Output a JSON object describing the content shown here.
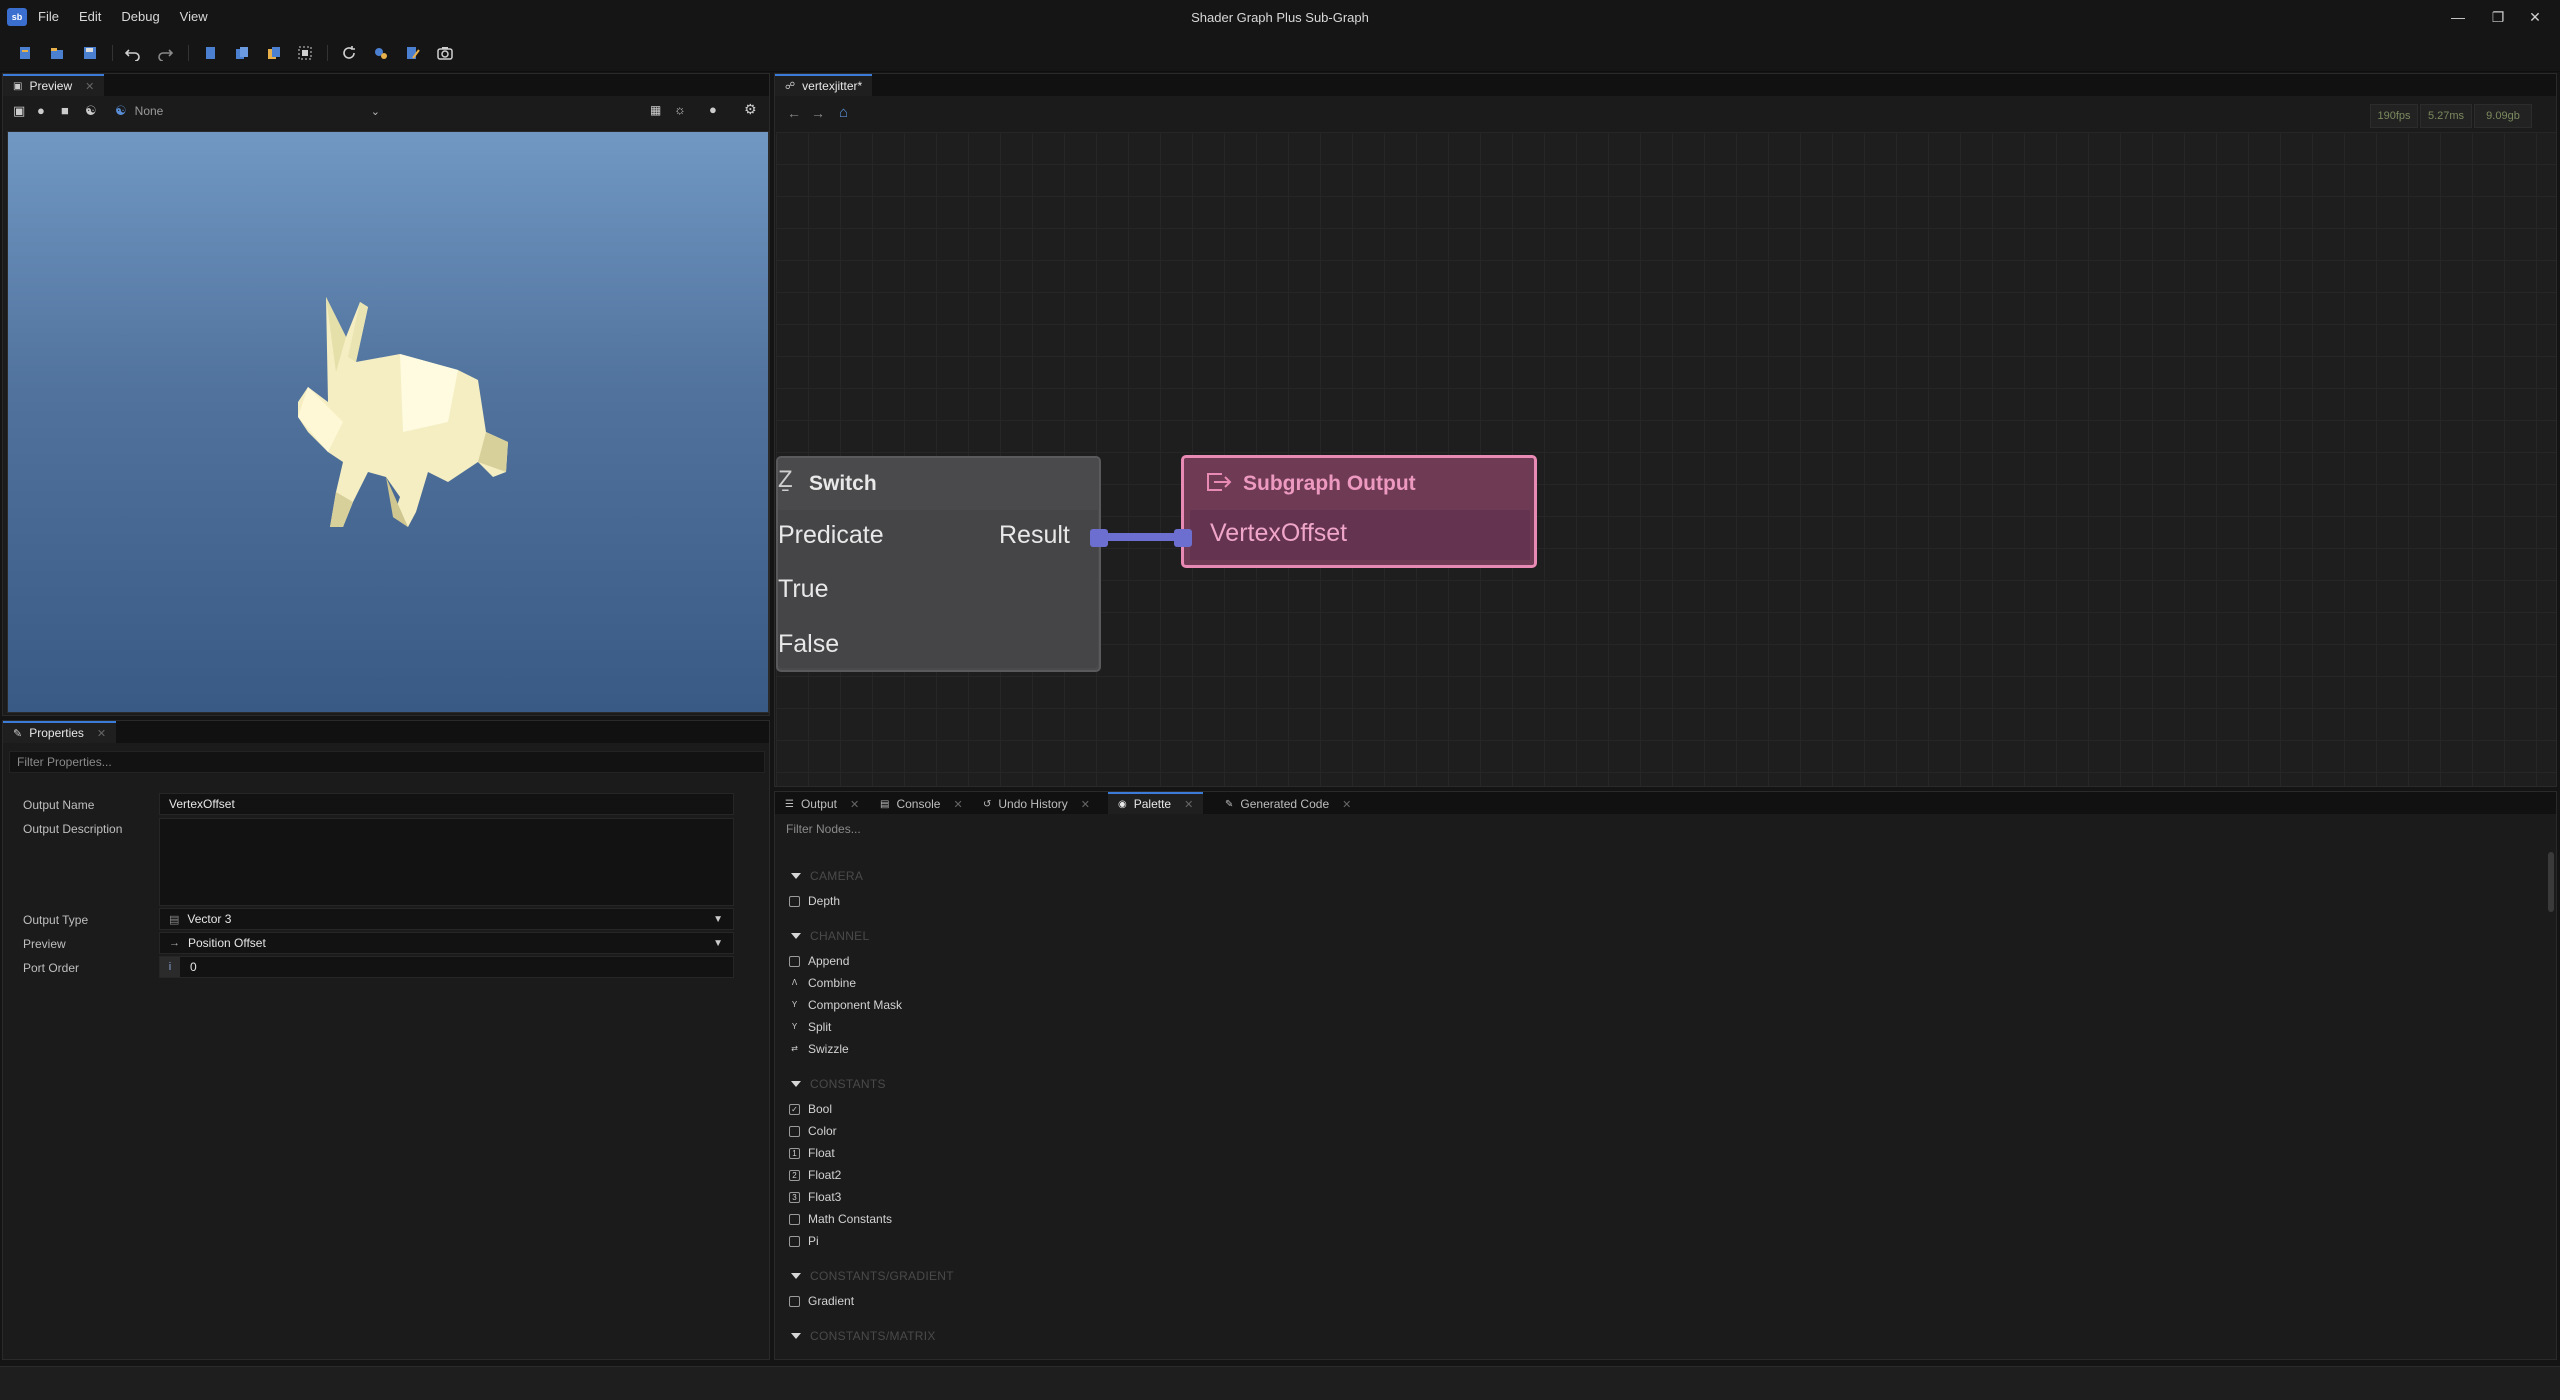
{
  "app": {
    "icon_text": "sb",
    "window_title": "Shader Graph Plus Sub-Graph",
    "menu": [
      "File",
      "Edit",
      "Debug",
      "View"
    ]
  },
  "toolbar": {
    "icons": [
      "new-file-icon",
      "open-folder-icon",
      "save-icon",
      "undo-icon",
      "redo-icon",
      "copy-icon",
      "paste-icon",
      "duplicate-icon",
      "select-all-icon",
      "refresh-icon",
      "compile-icon",
      "edit-icon",
      "screenshot-icon"
    ]
  },
  "preview": {
    "tab_label": "Preview",
    "model_select": "None"
  },
  "properties": {
    "tab_label": "Properties",
    "filter_placeholder": "Filter Properties...",
    "fields": {
      "output_name_label": "Output Name",
      "output_name_value": "VertexOffset",
      "output_description_label": "Output Description",
      "output_description_value": "",
      "output_type_label": "Output Type",
      "output_type_value": "Vector 3",
      "preview_label": "Preview",
      "preview_value": "Position Offset",
      "port_order_label": "Port Order",
      "port_order_value": "0",
      "port_order_badge": "i"
    }
  },
  "graph": {
    "tab_label": "vertexjitter*",
    "stats": {
      "fps": "190fps",
      "frame_time": "5.27ms",
      "memory": "9.09gb"
    },
    "switch_node": {
      "title": "Switch",
      "inputs": [
        "Predicate",
        "True",
        "False"
      ],
      "output": "Result"
    },
    "output_node": {
      "title": "Subgraph Output",
      "input": "VertexOffset"
    },
    "colors": {
      "wire": "#6d6fd0",
      "output_border": "#e88ab4",
      "output_fill": "#6e3a54"
    }
  },
  "bottom": {
    "tabs": [
      {
        "label": "Output",
        "icon": "list-icon"
      },
      {
        "label": "Console",
        "icon": "console-icon"
      },
      {
        "label": "Undo History",
        "icon": "history-icon"
      },
      {
        "label": "Palette",
        "icon": "palette-icon",
        "active": true
      },
      {
        "label": "Generated Code",
        "icon": "pencil-icon"
      }
    ],
    "filter_placeholder": "Filter Nodes...",
    "palette": [
      {
        "category": "CAMERA",
        "items": [
          "Depth"
        ]
      },
      {
        "category": "CHANNEL",
        "items": [
          "Append",
          "Combine",
          "Component Mask",
          "Split",
          "Swizzle"
        ]
      },
      {
        "category": "CONSTANTS",
        "items": [
          "Bool",
          "Color",
          "Float",
          "Float2",
          "Float3",
          "Math Constants",
          "Pi"
        ]
      },
      {
        "category": "CONSTANTS/GRADIENT",
        "items": [
          "Gradient"
        ]
      },
      {
        "category": "CONSTANTS/MATRIX",
        "items": []
      }
    ]
  }
}
